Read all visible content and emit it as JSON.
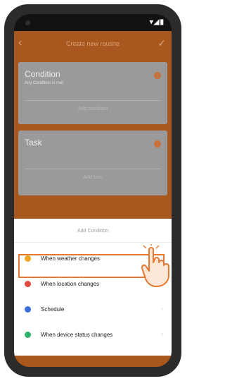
{
  "status_bar": {
    "icons": "▾◢▮"
  },
  "app_bar": {
    "title": "Create new routine",
    "back_icon": "arrow-back-icon",
    "confirm_icon": "check-icon"
  },
  "condition_card": {
    "title": "Condition",
    "subtitle": "Any Condition is met",
    "hint": "Add condition"
  },
  "task_card": {
    "title": "Task",
    "hint": "Add task"
  },
  "sheet": {
    "title": "Add Condition",
    "items": [
      {
        "label": "When weather changes",
        "icon": "sun-icon",
        "color": "#f2a51e"
      },
      {
        "label": "When location changes",
        "icon": "location-pin-icon",
        "color": "#e2493f"
      },
      {
        "label": "Schedule",
        "icon": "schedule-icon",
        "color": "#3a6fd8"
      },
      {
        "label": "When device status changes",
        "icon": "device-status-icon",
        "color": "#2fb36b"
      }
    ]
  },
  "highlight_color": "#e7782f"
}
